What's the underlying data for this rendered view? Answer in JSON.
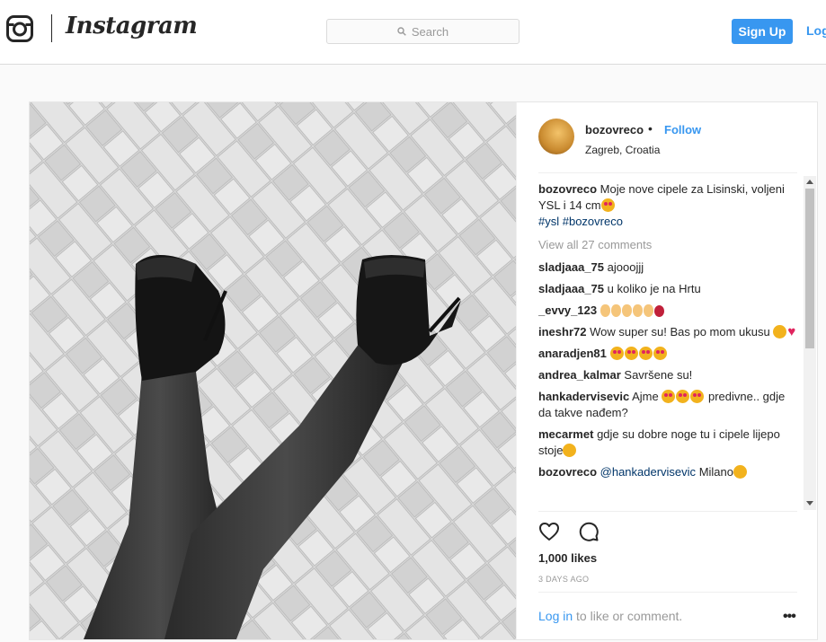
{
  "header": {
    "brand": "Instagram",
    "search_placeholder": "Search",
    "signup_label": "Sign Up",
    "login_label": "Log In"
  },
  "post": {
    "username": "bozovreco",
    "separator": "•",
    "follow_label": "Follow",
    "location": "Zagreb, Croatia",
    "caption": {
      "user": "bozovreco",
      "text": "Moje nove cipele za Lisinski, voljeni YSL i 14 cm",
      "tags": "#ysl #bozovreco"
    },
    "view_all": "View all 27 comments",
    "comments": [
      {
        "user": "sladjaaa_75",
        "text": "ajooojjj"
      },
      {
        "user": "sladjaaa_75",
        "text": "u koliko je na Hrtu"
      },
      {
        "user": "_evvy_123",
        "text": ""
      },
      {
        "user": "ineshr72",
        "text": "Wow super su! Bas po mom ukusu"
      },
      {
        "user": "anaradjen81",
        "text": ""
      },
      {
        "user": "andrea_kalmar",
        "text": "Savršene su!"
      },
      {
        "user": "hankadervisevic",
        "text_a": "Ajme",
        "text_b": "predivne.. gdje da takve nađem?"
      },
      {
        "user": "mecarmet",
        "text": "gdje su dobre noge tu i cipele lijepo stoje"
      },
      {
        "user": "bozovreco",
        "mention": "@hankadervisevic",
        "text": "Milano"
      }
    ],
    "likes": "1,000 likes",
    "time": "3 DAYS AGO",
    "login_link": "Log in",
    "login_rest": " to like or comment.",
    "more_label": "•••"
  },
  "colors": {
    "accent": "#3897f0",
    "hashtag": "#003569",
    "muted": "#999999"
  },
  "icons": [
    "instagram-glyph-icon",
    "search-icon",
    "heart-icon",
    "comment-icon",
    "more-options-icon"
  ]
}
